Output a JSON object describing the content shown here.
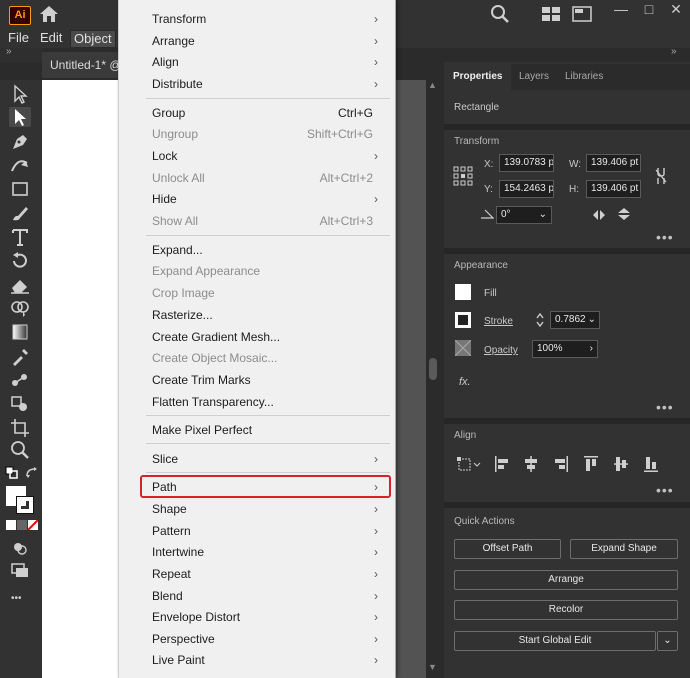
{
  "app": {
    "logo_text": "Ai",
    "accent": "#ff9a00",
    "highlight": "#d9212b"
  },
  "window_controls": [
    "—",
    "□",
    "✕"
  ],
  "menubar": {
    "items": [
      "File",
      "Edit",
      "Object"
    ]
  },
  "document": {
    "tab_label": "Untitled-1* @"
  },
  "object_menu": {
    "items": [
      {
        "label": "Transform",
        "submenu": true
      },
      {
        "label": "Arrange",
        "submenu": true
      },
      {
        "label": "Align",
        "submenu": true
      },
      {
        "label": "Distribute",
        "submenu": true
      },
      {
        "label": "Group",
        "shortcut": "Ctrl+G"
      },
      {
        "label": "Ungroup",
        "shortcut": "Shift+Ctrl+G",
        "disabled": true
      },
      {
        "label": "Lock",
        "submenu": true
      },
      {
        "label": "Unlock All",
        "shortcut": "Alt+Ctrl+2",
        "disabled": true
      },
      {
        "label": "Hide",
        "submenu": true
      },
      {
        "label": "Show All",
        "shortcut": "Alt+Ctrl+3",
        "disabled": true
      },
      {
        "label": "Expand..."
      },
      {
        "label": "Expand Appearance",
        "disabled": true
      },
      {
        "label": "Crop Image",
        "disabled": true
      },
      {
        "label": "Rasterize..."
      },
      {
        "label": "Create Gradient Mesh..."
      },
      {
        "label": "Create Object Mosaic...",
        "disabled": true
      },
      {
        "label": "Create Trim Marks"
      },
      {
        "label": "Flatten Transparency..."
      },
      {
        "label": "Make Pixel Perfect"
      },
      {
        "label": "Slice",
        "submenu": true
      },
      {
        "label": "Path",
        "submenu": true,
        "highlighted": true
      },
      {
        "label": "Shape",
        "submenu": true
      },
      {
        "label": "Pattern",
        "submenu": true
      },
      {
        "label": "Intertwine",
        "submenu": true
      },
      {
        "label": "Repeat",
        "submenu": true
      },
      {
        "label": "Blend",
        "submenu": true
      },
      {
        "label": "Envelope Distort",
        "submenu": true
      },
      {
        "label": "Perspective",
        "submenu": true
      },
      {
        "label": "Live Paint",
        "submenu": true
      }
    ],
    "submenu_arrow": "›"
  },
  "right_panel": {
    "tabs": [
      "Properties",
      "Layers",
      "Libraries"
    ],
    "selection_type": "Rectangle",
    "transform": {
      "title": "Transform",
      "x_label": "X:",
      "x_value": "139.0783 p",
      "y_label": "Y:",
      "y_value": "154.2463 p",
      "w_label": "W:",
      "w_value": "139.406 pt",
      "h_label": "H:",
      "h_value": "139.406 pt",
      "angle_value": "0°"
    },
    "appearance": {
      "title": "Appearance",
      "fill_label": "Fill",
      "stroke_label": "Stroke",
      "stroke_value": "0.7862",
      "opacity_label": "Opacity",
      "opacity_value": "100%",
      "fx_label": "fx."
    },
    "align": {
      "title": "Align"
    },
    "quick_actions": {
      "title": "Quick Actions",
      "offset_path": "Offset Path",
      "expand_shape": "Expand Shape",
      "arrange": "Arrange",
      "recolor": "Recolor",
      "start_global_edit": "Start Global Edit"
    },
    "more_glyph": "•••"
  },
  "toolbar": {
    "more_glyph": "•••",
    "collapse_glyph": "»"
  }
}
